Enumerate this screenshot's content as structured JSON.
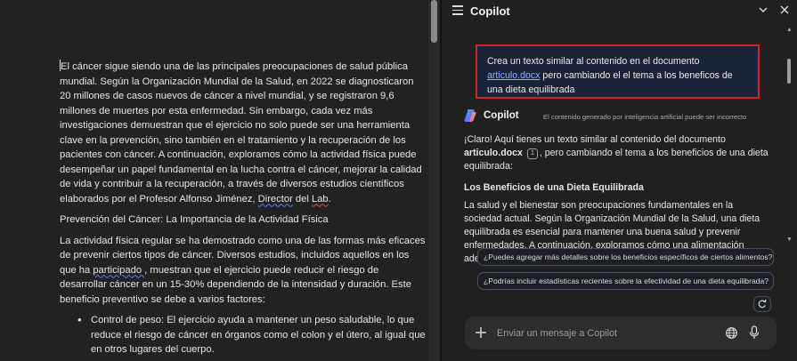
{
  "document": {
    "paragraphs": [
      "l cáncer sigue siendo una de las principales preocupaciones de salud pública mundial. Según la Organización Mundial de la Salud, en 2022 se diagnosticaron 20 millones de casos nuevos de cáncer a nivel mundial, y se registraron 9,6 millones de muertes por esta enfermedad. Sin embargo, cada vez más investigaciones demuestran que el ejercicio no solo puede ser una herramienta clave en la prevención, sino también en el tratamiento y la recuperación de los pacientes con cáncer. A continuación, exploramos cómo la actividad física puede desempeñar un papel fundamental en la lucha contra el cáncer, mejorar la calidad de vida y contribuir a la recuperación, a través de diversos estudios científicos elaborados por el Profesor Alfonso Jiménez, ",
      "Prevención del Cáncer: La Importancia de la Actividad Física"
    ],
    "para1_first_letter": "E",
    "para1_underlined_word": "Director",
    "para1_del": " del ",
    "para1_end_word": "Lab",
    "para1_end_dot": ".",
    "para3_a": "La actividad física regular se ha demostrado como una de las formas más eficaces de prevenir ciertos tipos de cáncer. Diversos estudios, incluidos aquellos en los que ha ",
    "para3_underlined": "participado ",
    "para3_b": ", muestran que el ejercicio puede reducir el riesgo de desarrollar cáncer en un 15-30% dependiendo de la intensidad y duración. Este beneficio preventivo se debe a varios factores:",
    "bullet_1": "Control de peso: El ejercicio ayuda a mantener un peso saludable, lo que reduce el riesgo de cáncer en órganos como el colon y el útero, al igual que en otros lugares del cuerpo."
  },
  "copilot": {
    "title": "Copilot",
    "user_message_before": "Crea un texto similar al contenido en el documento ",
    "user_message_link": "articulo.docx",
    "user_message_after": " pero cambiando el el tema a los beneficos de una dieta equilibrada",
    "brand_name": "Copilot",
    "disclaimer": "El contenido generado por inteligencia artificial puede ser incorrecto",
    "response_intro_1": "¡Claro! Aquí tienes un texto similar al contenido del documento ",
    "response_doc_name": "articulo.docx",
    "citation_number": "1",
    "response_intro_2": ", pero cambiando el tema a los beneficios de una dieta equilibrada:",
    "response_heading": "Los Beneficios de una Dieta Equilibrada",
    "response_body": "La salud y el bienestar son preocupaciones fundamentales en la sociedad actual. Según la Organización Mundial de la Salud, una dieta equilibrada es esencial para mantener una buena salud y prevenir enfermedades. A continuación, exploramos cómo una alimentación adecuada puede",
    "suggestions": [
      "¿Puedes agregar más detalles sobre los beneficios específicos de ciertos alimentos?",
      "¿Podrías incluir estadísticas recientes sobre la efectividad de una dieta equilibrada?"
    ],
    "input_placeholder": "Enviar un mensaje a Copilot",
    "icons": {
      "menu": "hamburger-menu-icon",
      "chevron": "chevron-down-icon",
      "close": "close-icon",
      "logo": "copilot-logo-icon",
      "refresh": "refresh-icon",
      "plus": "plus-icon",
      "globe": "globe-icon",
      "mic": "microphone-icon"
    },
    "colors": {
      "highlight_border": "#d32323",
      "link": "#8ab4ff",
      "user_bubble": "#1a2238"
    }
  }
}
